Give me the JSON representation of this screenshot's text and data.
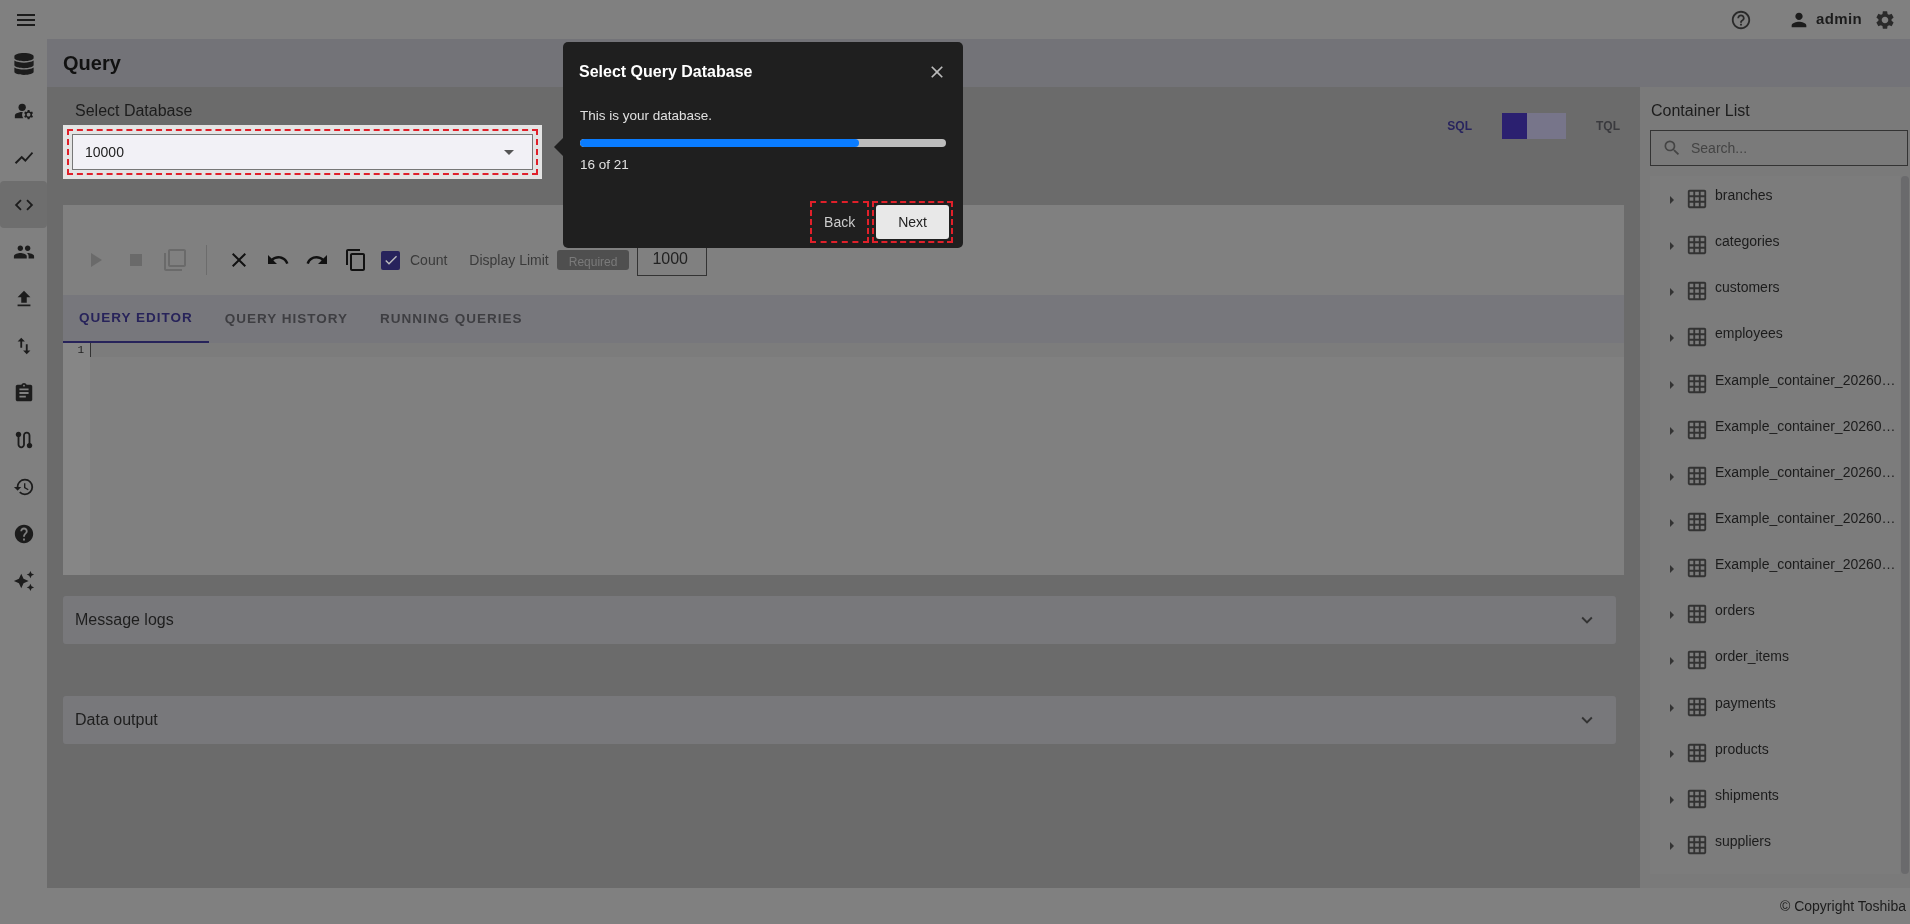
{
  "top_bar": {
    "user": "admin"
  },
  "sidebar": {
    "items": [
      {
        "kind": "database",
        "selected": false
      },
      {
        "kind": "user-gear",
        "selected": false
      },
      {
        "kind": "chart",
        "selected": false
      },
      {
        "kind": "code",
        "selected": true
      },
      {
        "kind": "users",
        "selected": false
      },
      {
        "kind": "upload",
        "selected": false
      },
      {
        "kind": "import-export",
        "selected": false
      },
      {
        "kind": "clipboard",
        "selected": false
      },
      {
        "kind": "route",
        "selected": false
      },
      {
        "kind": "restore",
        "selected": false
      },
      {
        "kind": "help",
        "selected": false
      },
      {
        "kind": "sparkles",
        "selected": false
      }
    ]
  },
  "page": {
    "title": "Query"
  },
  "database_select": {
    "label": "Select Database",
    "value": "10000"
  },
  "mode_toggle": {
    "options": [
      {
        "label": "SQL",
        "selected": true
      },
      {
        "label": "TQL",
        "selected": false
      }
    ]
  },
  "toolbar": {
    "buttons": [
      {
        "kind": "run",
        "disabled": true
      },
      {
        "kind": "stop",
        "disabled": true
      },
      {
        "kind": "duplicate",
        "disabled": true
      },
      {
        "kind": "clear",
        "disabled": false
      },
      {
        "kind": "undo",
        "disabled": false
      },
      {
        "kind": "redo",
        "disabled": false
      },
      {
        "kind": "copy",
        "disabled": false
      }
    ],
    "count": {
      "label": "Count",
      "checked": true
    },
    "display_limit": {
      "label": "Display Limit",
      "badge": "Required",
      "value": "1000"
    }
  },
  "tabs": [
    {
      "label": "QUERY EDITOR",
      "selected": true
    },
    {
      "label": "QUERY HISTORY",
      "selected": false
    },
    {
      "label": "RUNNING QUERIES",
      "selected": false
    }
  ],
  "editor": {
    "line_numbers": [
      "1"
    ]
  },
  "panels": [
    {
      "title": "Message logs",
      "expanded": false
    },
    {
      "title": "Data output",
      "expanded": false
    }
  ],
  "container_list": {
    "title": "Container List",
    "search": {
      "placeholder": "Search..."
    },
    "items": [
      {
        "name": "branches",
        "expanded": false
      },
      {
        "name": "categories",
        "expanded": false
      },
      {
        "name": "customers",
        "expanded": false
      },
      {
        "name": "employees",
        "expanded": false
      },
      {
        "name": "Example_container_20260…",
        "expanded": false
      },
      {
        "name": "Example_container_20260…",
        "expanded": false
      },
      {
        "name": "Example_container_20260…",
        "expanded": false
      },
      {
        "name": "Example_container_20260…",
        "expanded": false
      },
      {
        "name": "Example_container_20260…",
        "expanded": false
      },
      {
        "name": "orders",
        "expanded": false
      },
      {
        "name": "order_items",
        "expanded": false
      },
      {
        "name": "payments",
        "expanded": false
      },
      {
        "name": "products",
        "expanded": false
      },
      {
        "name": "shipments",
        "expanded": false
      },
      {
        "name": "suppliers",
        "expanded": false
      }
    ]
  },
  "footer": {
    "copyright": "© Copyright Toshiba"
  },
  "tour": {
    "title": "Select Query Database",
    "text": "This is your database.",
    "level": 0.762,
    "progress": "16 of 21",
    "buttons": [
      {
        "label": "Back",
        "kind": "secondary"
      },
      {
        "label": "Next",
        "kind": "primary"
      }
    ]
  }
}
